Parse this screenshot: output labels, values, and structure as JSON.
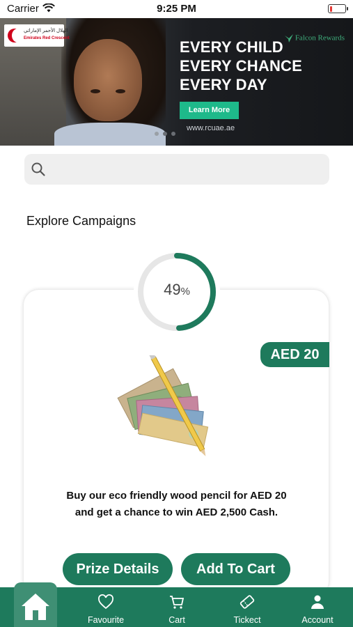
{
  "status_bar": {
    "carrier": "Carrier",
    "time": "9:25 PM"
  },
  "banner": {
    "logo_arabic": "الهلال الأحمر الإماراتي",
    "logo_english": "Emirates Red Crescent",
    "headline": [
      "EVERY CHILD",
      "EVERY CHANCE",
      "EVERY DAY"
    ],
    "cta_label": "Learn More",
    "url": "www.rcuae.ae",
    "rewards_brand": "Falcon Rewards"
  },
  "search": {
    "placeholder": "",
    "value": ""
  },
  "section_title": "Explore Campaigns",
  "campaign": {
    "progress_percent": 49,
    "progress_number": "49",
    "progress_unit": "%",
    "price": "AED 20",
    "description": "Buy our eco friendly wood pencil for AED 20 and get a chance to win AED 2,500 Cash.",
    "prize_details_label": "Prize Details",
    "add_to_cart_label": "Add To Cart"
  },
  "tabbar": {
    "items": [
      {
        "label": "",
        "icon": "home-icon"
      },
      {
        "label": "Favourite",
        "icon": "heart-icon"
      },
      {
        "label": "Cart",
        "icon": "cart-icon"
      },
      {
        "label": "Tickect",
        "icon": "ticket-icon"
      },
      {
        "label": "Account",
        "icon": "account-icon"
      }
    ]
  },
  "colors": {
    "brand_green": "#1e7a5c",
    "ring_track": "#e6e6e6",
    "cta_green": "#1eb98a"
  }
}
